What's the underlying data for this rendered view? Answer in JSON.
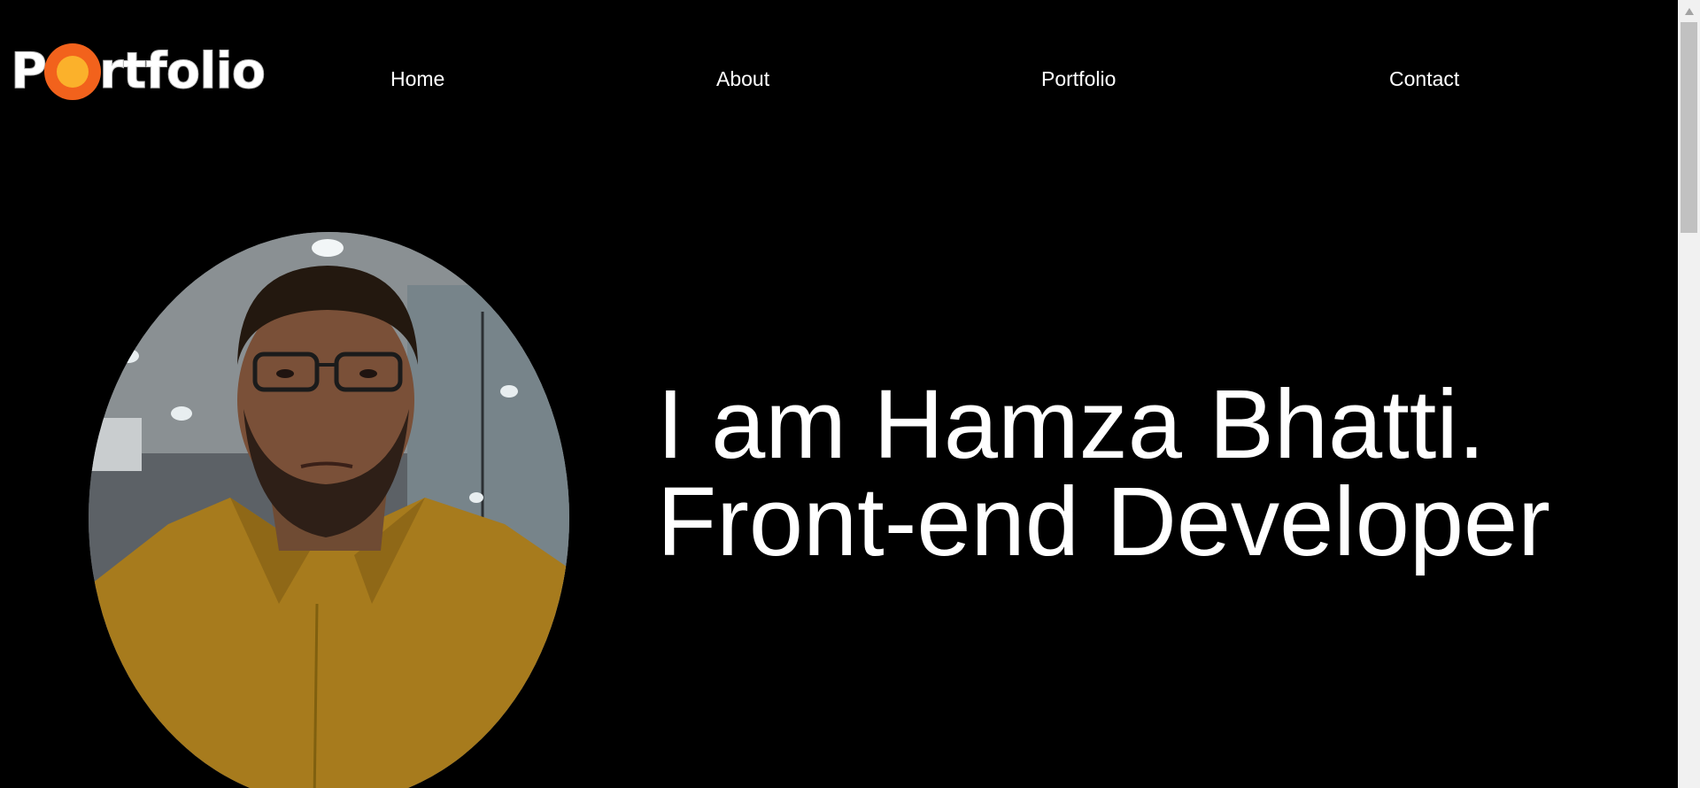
{
  "header": {
    "logo": {
      "prefix": "P",
      "suffix": "rtfolio"
    },
    "nav": {
      "home": "Home",
      "about": "About",
      "portfolio": "Portfolio",
      "contact": "Contact"
    }
  },
  "hero": {
    "headline_line1": "I am Hamza Bhatti.",
    "headline_line2": "Front-end Developer"
  },
  "colors": {
    "background": "#000000",
    "text": "#ffffff",
    "logo_ring": "#f2621c",
    "logo_core": "#fbb12b"
  },
  "icons": {
    "scroll_up": "triangle-up-icon"
  }
}
